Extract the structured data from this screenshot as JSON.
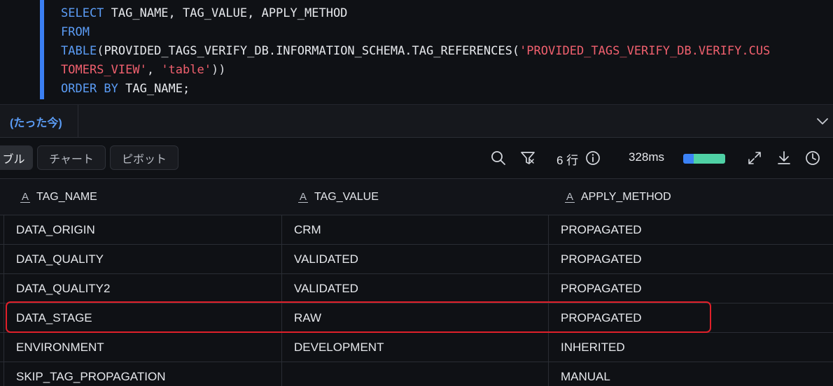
{
  "editor": {
    "line1": {
      "kw": "SELECT",
      "rest": " TAG_NAME, TAG_VALUE, APPLY_METHOD"
    },
    "line2": {
      "kw": "FROM"
    },
    "line3": {
      "kw": "TABLE",
      "open": "(",
      "fn": "PROVIDED_TAGS_VERIFY_DB.INFORMATION_SCHEMA.TAG_REFERENCES(",
      "str": "'PROVIDED_TAGS_VERIFY_DB.VERIFY.CUS"
    },
    "line4": {
      "str1": "TOMERS_VIEW'",
      "sep": ", ",
      "str2": "'table'",
      "close": "))"
    },
    "line5": {
      "kw": "ORDER BY",
      "rest": " TAG_NAME;"
    }
  },
  "result_tab": {
    "label": "(たった今)"
  },
  "toolbar": {
    "table_label": "ブル",
    "chart_label": "チャート",
    "pivot_label": "ピボット",
    "rows_text": "6 行",
    "time_text": "328ms",
    "colors": {
      "bar_blue": "#3b82f6",
      "bar_green": "#4fd1a5"
    }
  },
  "table": {
    "headers": [
      "TAG_NAME",
      "TAG_VALUE",
      "APPLY_METHOD"
    ],
    "rows": [
      [
        "DATA_ORIGIN",
        "CRM",
        "PROPAGATED"
      ],
      [
        "DATA_QUALITY",
        "VALIDATED",
        "PROPAGATED"
      ],
      [
        "DATA_QUALITY2",
        "VALIDATED",
        "PROPAGATED"
      ],
      [
        "DATA_STAGE",
        "RAW",
        "PROPAGATED"
      ],
      [
        "ENVIRONMENT",
        "DEVELOPMENT",
        "INHERITED"
      ],
      [
        "SKIP_TAG_PROPAGATION",
        "",
        "MANUAL"
      ]
    ],
    "highlighted_row": "DATA_STAGE"
  },
  "colors": {
    "accent": "#5b9cf5",
    "highlight": "#e0202a"
  }
}
